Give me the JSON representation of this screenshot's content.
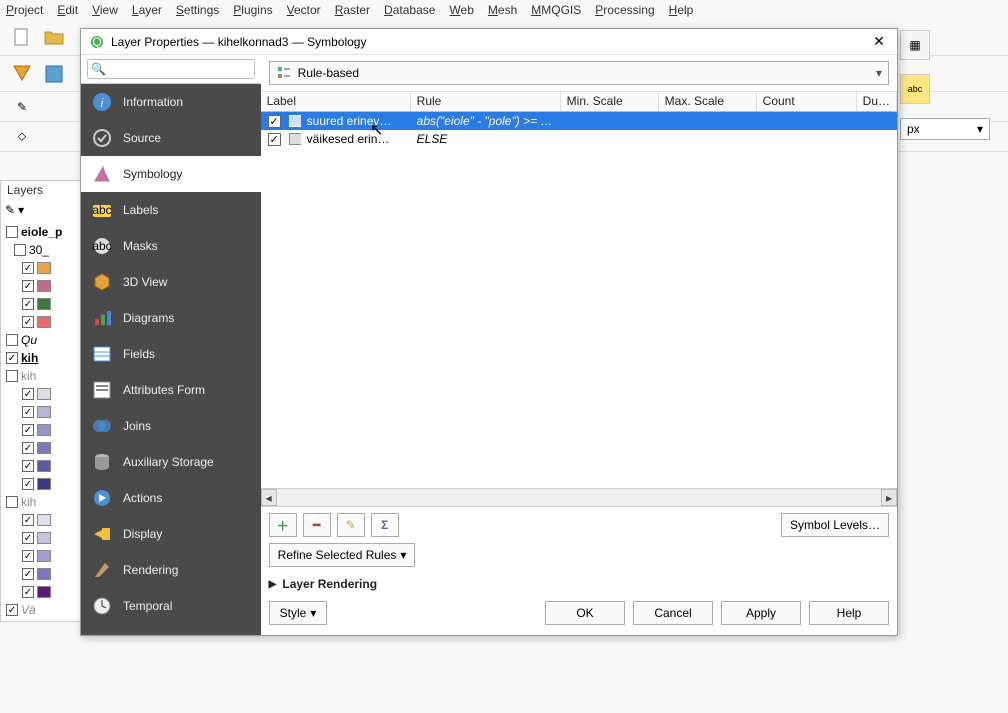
{
  "menu": [
    "Project",
    "Edit",
    "View",
    "Layer",
    "Settings",
    "Plugins",
    "Vector",
    "Raster",
    "Database",
    "Web",
    "Mesh",
    "MMQGIS",
    "Processing",
    "Help"
  ],
  "dialog": {
    "title": "Layer Properties — kihelkonnad3 — Symbology",
    "search_placeholder": "",
    "sidebar": [
      {
        "id": "information",
        "label": "Information"
      },
      {
        "id": "source",
        "label": "Source"
      },
      {
        "id": "symbology",
        "label": "Symbology",
        "active": true
      },
      {
        "id": "labels",
        "label": "Labels"
      },
      {
        "id": "masks",
        "label": "Masks"
      },
      {
        "id": "3dview",
        "label": "3D View"
      },
      {
        "id": "diagrams",
        "label": "Diagrams"
      },
      {
        "id": "fields",
        "label": "Fields"
      },
      {
        "id": "attributesform",
        "label": "Attributes Form"
      },
      {
        "id": "joins",
        "label": "Joins"
      },
      {
        "id": "auxstorage",
        "label": "Auxiliary Storage"
      },
      {
        "id": "actions",
        "label": "Actions"
      },
      {
        "id": "display",
        "label": "Display"
      },
      {
        "id": "rendering",
        "label": "Rendering"
      },
      {
        "id": "temporal",
        "label": "Temporal"
      }
    ],
    "renderer": "Rule-based",
    "columns": {
      "label": "Label",
      "rule": "Rule",
      "min": "Min. Scale",
      "max": "Max. Scale",
      "count": "Count",
      "dup": "Du…"
    },
    "rules": [
      {
        "checked": true,
        "label": "suured erinev…",
        "rule": "abs(\"eiole\" -  \"pole\") >= …",
        "selected": true
      },
      {
        "checked": true,
        "label": "väikesed erin…",
        "rule": "ELSE",
        "selected": false
      }
    ],
    "symbol_levels": "Symbol Levels…",
    "refine": "Refine Selected Rules",
    "layer_rendering": "Layer Rendering",
    "style": "Style",
    "buttons": {
      "ok": "OK",
      "cancel": "Cancel",
      "apply": "Apply",
      "help": "Help"
    }
  },
  "layers_panel": {
    "title": "Layers",
    "items": [
      {
        "label": "eiole_p",
        "bold": true
      },
      {
        "label": "30_",
        "indent": 1
      },
      {
        "swatch": "#e8a24a",
        "indent": 2,
        "checked": true
      },
      {
        "swatch": "#c36a8a",
        "indent": 2,
        "checked": true
      },
      {
        "swatch": "#3a7a3a",
        "indent": 2,
        "checked": true
      },
      {
        "swatch": "#e86a6a",
        "indent": 2,
        "checked": true
      },
      {
        "label": "Qu",
        "italic": true
      },
      {
        "label": "kih",
        "checked": true,
        "bold": true,
        "underline": true
      },
      {
        "label": "kih",
        "ghost": true
      },
      {
        "swatch": "#dcdce8",
        "indent": 2,
        "checked": true
      },
      {
        "swatch": "#b6b6d8",
        "indent": 2,
        "checked": true
      },
      {
        "swatch": "#9494c6",
        "indent": 2,
        "checked": true
      },
      {
        "swatch": "#7a7ab8",
        "indent": 2,
        "checked": true
      },
      {
        "swatch": "#5a5aa0",
        "indent": 2,
        "checked": true
      },
      {
        "swatch": "#3a3a80",
        "indent": 2,
        "checked": true
      },
      {
        "label": "kih",
        "ghost": true
      },
      {
        "swatch": "#e0def0",
        "indent": 2,
        "checked": true
      },
      {
        "swatch": "#c6c2e2",
        "indent": 2,
        "checked": true
      },
      {
        "swatch": "#a29ed0",
        "indent": 2,
        "checked": true
      },
      {
        "swatch": "#7c76be",
        "indent": 2,
        "checked": true
      },
      {
        "swatch": "#5a1a7a",
        "indent": 2,
        "checked": true
      },
      {
        "label": "Vä",
        "italic": true,
        "checked": true,
        "ghost": true
      }
    ]
  },
  "right_units": "px"
}
